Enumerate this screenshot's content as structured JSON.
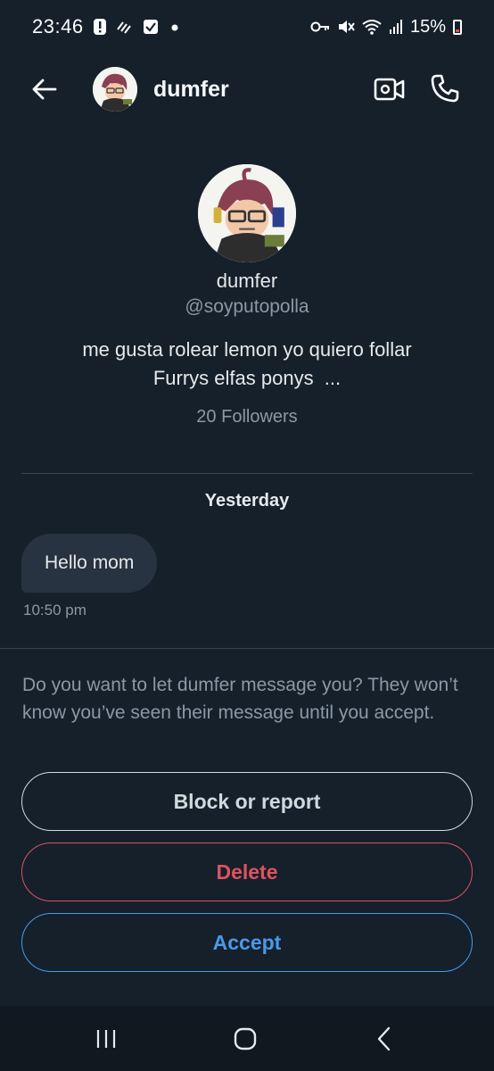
{
  "status_bar": {
    "time": "23:46",
    "battery": "15%",
    "icons_left": [
      "alert-icon",
      "sync-icon",
      "checkbox-icon",
      "dot-icon"
    ],
    "icons_right": [
      "key-icon",
      "mute-icon",
      "wifi-icon",
      "signal-icon",
      "battery-icon"
    ]
  },
  "header": {
    "name": "dumfer",
    "icons": [
      "back-arrow-icon",
      "video-call-icon",
      "phone-icon"
    ]
  },
  "profile": {
    "name": "dumfer",
    "handle": "@soyputopolla",
    "bio_line1": "me gusta rolear lemon yo quiero follar",
    "bio_line2": "Furrys elfas ponys  ...",
    "followers": "20 Followers"
  },
  "conversation": {
    "date_label": "Yesterday",
    "messages": [
      {
        "text": "Hello mom",
        "time": "10:50 pm"
      }
    ]
  },
  "request": {
    "prompt": "Do you want to let dumfer message you? They won’t know you’ve seen their message until you accept.",
    "block_label": "Block or report",
    "delete_label": "Delete",
    "accept_label": "Accept"
  },
  "colors": {
    "background": "#15202b",
    "delete": "#e0525e",
    "accept": "#4a99e9",
    "muted": "#8b98a5",
    "bubble": "#273340"
  },
  "nav_bar": {
    "icons": [
      "recents-icon",
      "home-icon",
      "back-icon"
    ]
  }
}
